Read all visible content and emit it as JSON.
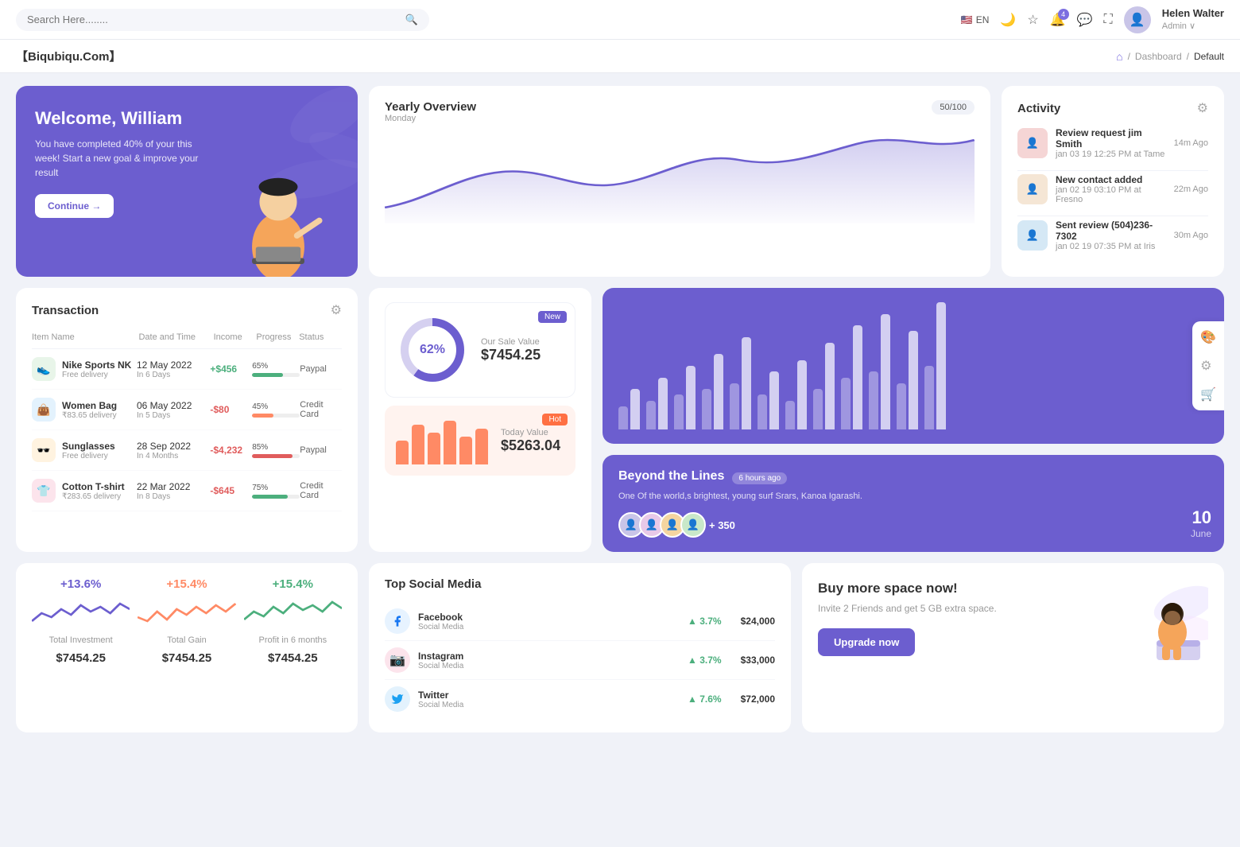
{
  "topnav": {
    "search_placeholder": "Search Here........",
    "lang": "EN",
    "user": {
      "name": "Helen Walter",
      "role": "Admin"
    },
    "notifications_count": "4"
  },
  "breadcrumb": {
    "brand": "【Biqubiqu.Com】",
    "home_label": "⌂",
    "separator": "/",
    "dashboard": "Dashboard",
    "current": "Default"
  },
  "welcome": {
    "title": "Welcome, William",
    "subtitle": "You have completed 40% of your this week! Start a new goal & improve your result",
    "button": "Continue →"
  },
  "yearly_overview": {
    "title": "Yearly Overview",
    "subtitle": "Monday",
    "progress": "50/100"
  },
  "activity": {
    "title": "Activity",
    "items": [
      {
        "title": "Review request jim Smith",
        "sub": "jan 03 19 12:25 PM at Tame",
        "time": "14m Ago"
      },
      {
        "title": "New contact added",
        "sub": "jan 02 19 03:10 PM at Fresno",
        "time": "22m Ago"
      },
      {
        "title": "Sent review (504)236-7302",
        "sub": "jan 02 19 07:35 PM at Iris",
        "time": "30m Ago"
      }
    ]
  },
  "transaction": {
    "title": "Transaction",
    "headers": [
      "Item Name",
      "Date and Time",
      "Income",
      "Progress",
      "Status"
    ],
    "rows": [
      {
        "icon": "👟",
        "name": "Nike Sports NK",
        "sub": "Free delivery",
        "date": "12 May 2022",
        "days": "In 6 Days",
        "income": "+$456",
        "income_type": "pos",
        "progress": 65,
        "status": "Paypal"
      },
      {
        "icon": "👜",
        "name": "Women Bag",
        "sub": "₹83.65 delivery",
        "date": "06 May 2022",
        "days": "In 5 Days",
        "income": "-$80",
        "income_type": "neg",
        "progress": 45,
        "status": "Credit Card"
      },
      {
        "icon": "🕶️",
        "name": "Sunglasses",
        "sub": "Free delivery",
        "date": "28 Sep 2022",
        "days": "In 4 Months",
        "income": "-$4,232",
        "income_type": "neg",
        "progress": 85,
        "status": "Paypal"
      },
      {
        "icon": "👕",
        "name": "Cotton T-shirt",
        "sub": "₹283.65 delivery",
        "date": "22 Mar 2022",
        "days": "In 8 Days",
        "income": "-$645",
        "income_type": "neg",
        "progress": 75,
        "status": "Credit Card"
      }
    ]
  },
  "sale_value": {
    "donut_pct": "62%",
    "donut_value": 62,
    "title": "Our Sale Value",
    "amount": "$7454.25",
    "badge": "New",
    "today_title": "Today Value",
    "today_amount": "$5263.04",
    "today_badge": "Hot",
    "bars": [
      30,
      50,
      40,
      60,
      45,
      55
    ]
  },
  "bar_chart": {
    "groups": [
      [
        20,
        35
      ],
      [
        25,
        45
      ],
      [
        30,
        55
      ],
      [
        35,
        65
      ],
      [
        40,
        80
      ],
      [
        30,
        50
      ],
      [
        25,
        60
      ],
      [
        35,
        75
      ],
      [
        45,
        90
      ],
      [
        50,
        100
      ],
      [
        40,
        85
      ],
      [
        55,
        110
      ]
    ]
  },
  "beyond": {
    "title": "Beyond the Lines",
    "time_ago": "6 hours ago",
    "sub": "One Of the world,s brightest, young surf Srars, Kanoa Igarashi.",
    "plus_count": "+ 350",
    "day": "10",
    "month": "June"
  },
  "stats": [
    {
      "percent": "+13.6%",
      "label": "Total Investment",
      "value": "$7454.25",
      "color": "purple"
    },
    {
      "percent": "+15.4%",
      "label": "Total Gain",
      "value": "$7454.25",
      "color": "orange"
    },
    {
      "percent": "+15.4%",
      "label": "Profit in 6 months",
      "value": "$7454.25",
      "color": "green"
    }
  ],
  "social_media": {
    "title": "Top Social Media",
    "items": [
      {
        "name": "Facebook",
        "sub": "Social Media",
        "pct": "3.7%",
        "amount": "$24,000",
        "color": "#1877f2",
        "icon": "f"
      },
      {
        "name": "Instagram",
        "sub": "Social Media",
        "pct": "3.7%",
        "amount": "$33,000",
        "color": "#e4405f",
        "icon": "📷"
      },
      {
        "name": "Twitter",
        "sub": "Social Media",
        "pct": "7.6%",
        "amount": "$72,000",
        "color": "#1da1f2",
        "icon": "t"
      }
    ]
  },
  "buy_space": {
    "title": "Buy more space now!",
    "sub": "Invite 2 Friends and get 5 GB extra space.",
    "button": "Upgrade now"
  }
}
